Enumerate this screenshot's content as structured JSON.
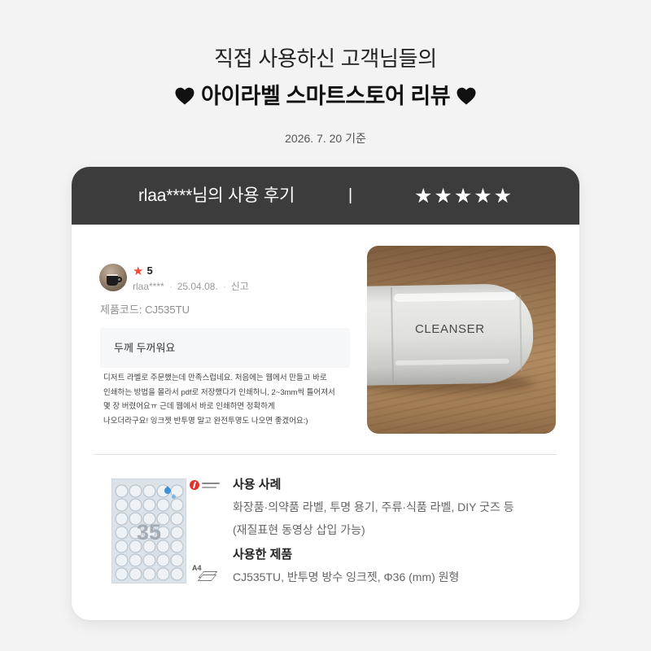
{
  "colors": {
    "page_background": "#f3f3f3",
    "card_header": "#3c3c3c",
    "rating_star": "#f24a35",
    "heading_text": "#111111",
    "muted_text": "#8e8e8e"
  },
  "header": {
    "line1": "직접 사용하신 고객님들의",
    "line2": "아이라벨 스마트스토어 리뷰",
    "icon": "heart-icon",
    "date_note": "2026. 7. 20 기준"
  },
  "card": {
    "title": "rlaa****님의 사용 후기",
    "separator": "|",
    "stars": "★★★★★"
  },
  "review": {
    "star_icon": "★",
    "rating": "5",
    "username": "rlaa****",
    "separator": "·",
    "date": "25.04.08.",
    "report": "신고",
    "product_code": "제품코드: CJ535TU",
    "summary": "두께 두꺼워요",
    "body_lines": [
      "디저트 라벨로 주문했는데 만족스럽네요. 처음에는 웹에서 만들고 바로",
      "인쇄하는 방법을 몰라서 pdf로 저장했다가 인쇄하니, 2~3mm씩 틀어져서",
      "몇 장 버렸어요ㅠ 근데 웹에서 바로 인쇄하면 정확하게",
      "나오더라구요! 잉크젯 반투명 말고 완전투명도 나오면 좋겠어요:)"
    ],
    "photo": {
      "label_text": "CLEANSER"
    }
  },
  "product": {
    "sheet_count_label": "35",
    "paper_size": "A4",
    "usage_title": "사용 사례",
    "usage_lines": [
      "화장품·의약품 라벨, 투명 용기, 주류·식품 라벨, DIY 굿즈 등",
      "(재질표현 동영상 삽입 가능)"
    ],
    "used_title": "사용한 제품",
    "used_description": "CJ535TU, 반투명 방수 잉크젯, Φ36 (mm) 원형"
  }
}
